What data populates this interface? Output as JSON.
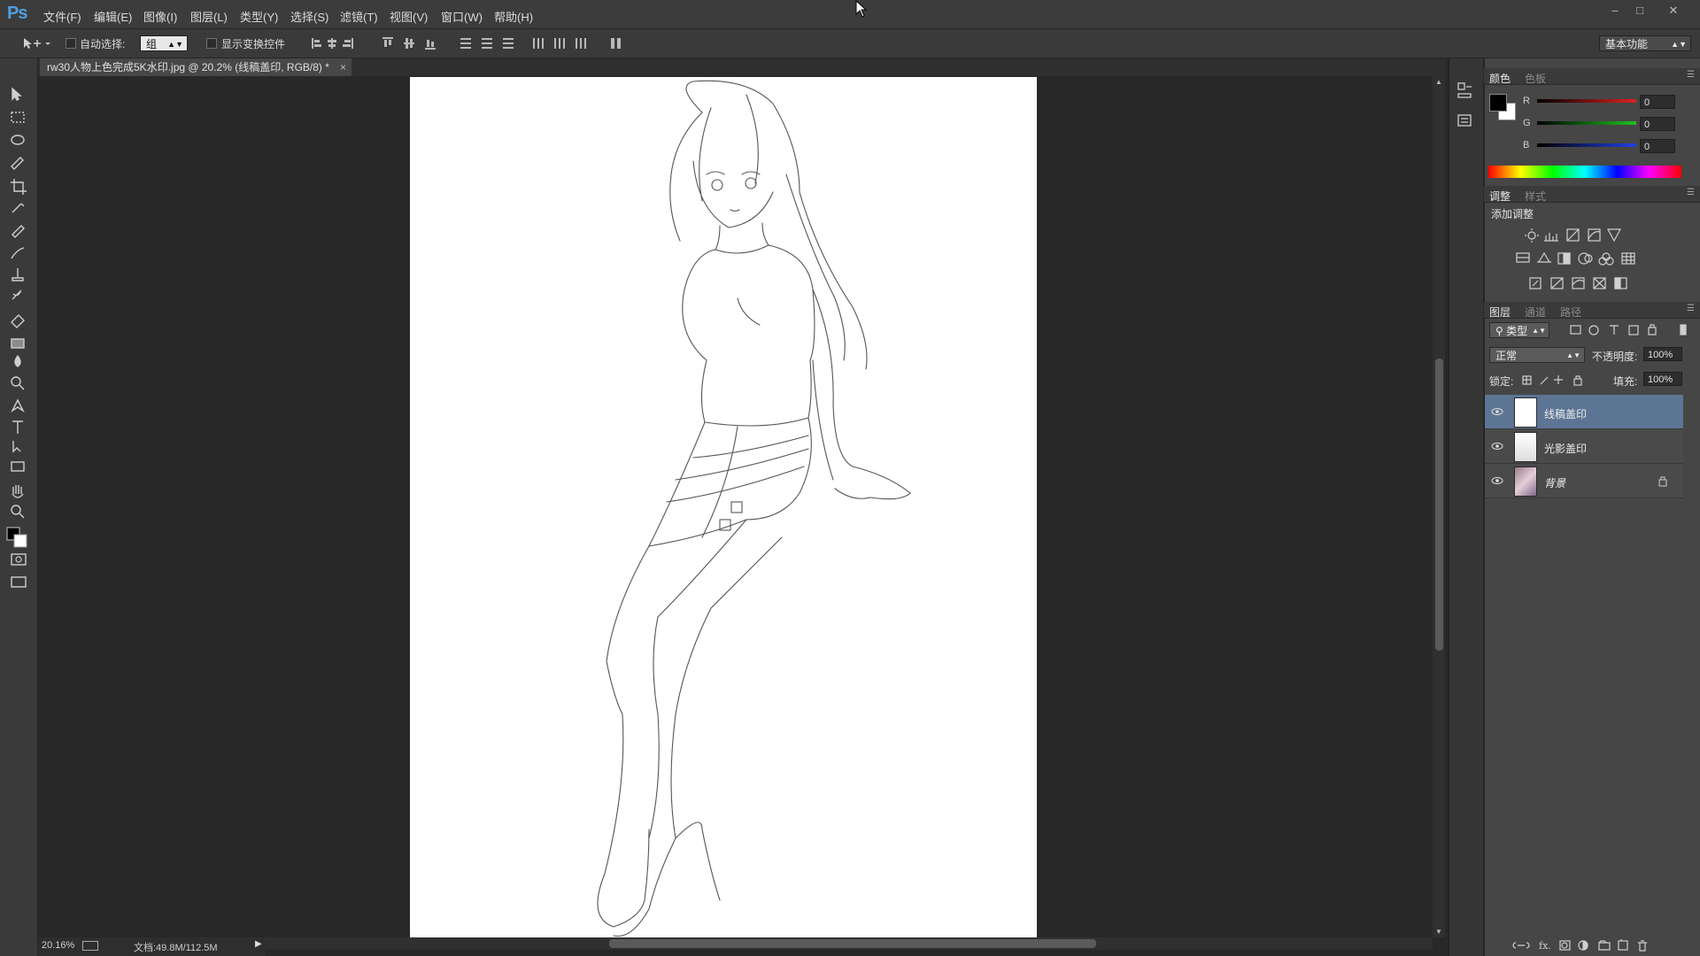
{
  "app": {
    "logo": "Ps"
  },
  "menu": [
    "文件(F)",
    "编辑(E)",
    "图像(I)",
    "图层(L)",
    "类型(Y)",
    "选择(S)",
    "滤镜(T)",
    "视图(V)",
    "窗口(W)",
    "帮助(H)"
  ],
  "options": {
    "auto_select_label": "自动选择:",
    "auto_select_value": "组",
    "show_transform_label": "显示变换控件",
    "workspace": "基本功能"
  },
  "document": {
    "tab_title": "rw30人物上色完成5K水印.jpg @ 20.2% (线稿盖印, RGB/8) *"
  },
  "status": {
    "zoom": "20.16%",
    "doc_info": "文档:49.8M/112.5M"
  },
  "color_panel": {
    "tabs": [
      "颜色",
      "色板"
    ],
    "channels": [
      {
        "label": "R",
        "value": "0",
        "color": "#e02020"
      },
      {
        "label": "G",
        "value": "0",
        "color": "#20c020"
      },
      {
        "label": "B",
        "value": "0",
        "color": "#2040e0"
      }
    ]
  },
  "adjust_panel": {
    "tabs": [
      "调整",
      "样式"
    ],
    "title": "添加调整"
  },
  "layers_panel": {
    "tabs": [
      "图层",
      "通道",
      "路径"
    ],
    "filter_kind": "类型",
    "blend_mode": "正常",
    "opacity_label": "不透明度:",
    "opacity": "100%",
    "lock_label": "锁定:",
    "fill_label": "填充:",
    "fill": "100%",
    "layers": [
      {
        "name": "线稿盖印",
        "selected": true
      },
      {
        "name": "光影盖印",
        "selected": false
      },
      {
        "name": "背景",
        "selected": false,
        "locked": true
      }
    ]
  }
}
